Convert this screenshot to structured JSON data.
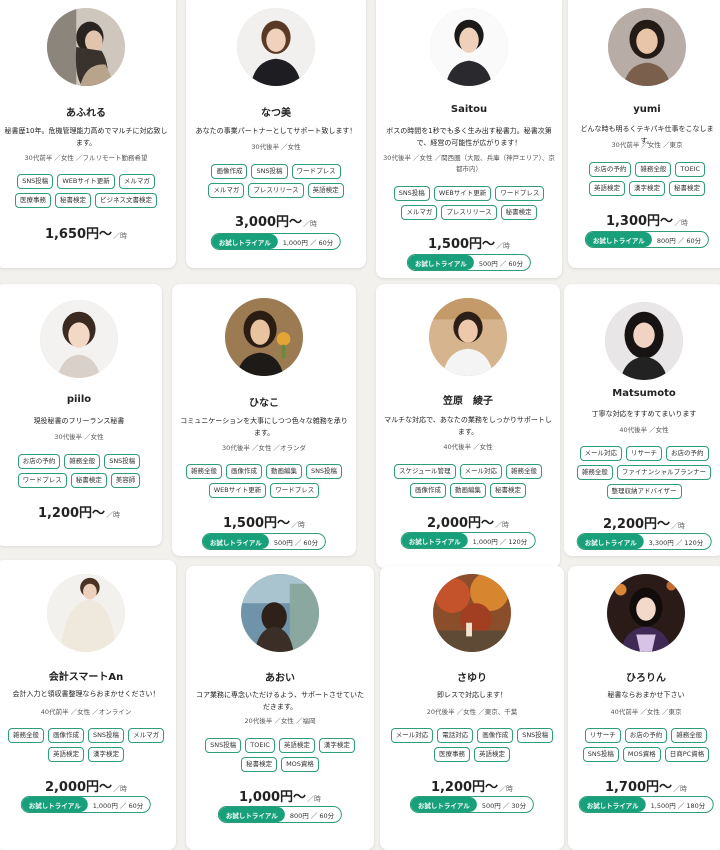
{
  "cards": [
    {
      "name": "あふれる",
      "intro": "秘書歴10年。危機管理能力高めでマルチに対応致します。",
      "meta": "30代前半 ／女性 ／フルリモート勤務希望",
      "tags": [
        "SNS投稿",
        "WEBサイト更新",
        "メルマガ",
        "医療事務",
        "秘書検定",
        "ビジネス文書検定"
      ],
      "price": "1,650円〜",
      "unit": "／時",
      "trial_label": "",
      "trial_detail": "",
      "photo": "woman-long-hair-side"
    },
    {
      "name": "なつ美",
      "intro": "あなたの事業パートナーとしてサポート致します！",
      "meta": "30代後半 ／女性",
      "tags": [
        "画像作成",
        "SNS投稿",
        "ワードプレス",
        "メルマガ",
        "プレスリリース",
        "英語検定"
      ],
      "price": "3,000円〜",
      "unit": "／時",
      "trial_label": "お試しトライアル",
      "trial_detail": "1,000円 ／ 60分",
      "photo": "woman-short-hair"
    },
    {
      "name": "Saitou",
      "intro": "ボスの時間を1秒でも多く生み出す秘書力。秘書次第で、経営の可能性が広がります！",
      "meta": "30代後半 ／女性 ／関西圏（大阪、兵庫（神戸エリア）、京都市内）",
      "tags": [
        "SNS投稿",
        "WEBサイト更新",
        "ワードプレス",
        "メルマガ",
        "プレスリリース",
        "秘書検定"
      ],
      "price": "1,500円〜",
      "unit": "／時",
      "trial_label": "お試しトライアル",
      "trial_detail": "500円 ／ 60分",
      "photo": "woman-tied-hair"
    },
    {
      "name": "yumi",
      "intro": "どんな時も明るくテキパキ仕事をこなします。",
      "meta": "30代前半 ／女性 ／東京",
      "tags": [
        "お店の予約",
        "雑務全般",
        "TOEIC",
        "英語検定",
        "漢字検定",
        "秘書検定"
      ],
      "price": "1,300円〜",
      "unit": "／時",
      "trial_label": "お試しトライアル",
      "trial_detail": "800円 ／ 60分",
      "photo": "woman-dark-hair"
    },
    {
      "name": "piilo",
      "intro": "現役秘書のフリーランス秘書",
      "meta": "30代後半 ／女性",
      "tags": [
        "お店の予約",
        "雑務全般",
        "SNS投稿",
        "ワードプレス",
        "秘書検定",
        "美容師"
      ],
      "price": "1,200円〜",
      "unit": "／時",
      "trial_label": "",
      "trial_detail": "",
      "photo": "woman-bangs"
    },
    {
      "name": "ひなこ",
      "intro": "コミュニケーションを大事にしつつ色々な雑務を承ります。",
      "meta": "30代後半 ／女性 ／オランダ",
      "tags": [
        "雑務全般",
        "画像作成",
        "動画編集",
        "SNS投稿",
        "WEBサイト更新",
        "ワードプレス"
      ],
      "price": "1,500円〜",
      "unit": "／時",
      "trial_label": "お試しトライアル",
      "trial_detail": "500円 ／ 60分",
      "photo": "woman-holding-flower"
    },
    {
      "name": "笠原　綾子",
      "intro": "マルチな対応で、あなたの業務をしっかりサポートします。",
      "meta": "40代後半 ／女性",
      "tags": [
        "スケジュール管理",
        "メール対応",
        "雑務全般",
        "画像作成",
        "動画編集",
        "秘書検定"
      ],
      "price": "2,000円〜",
      "unit": "／時",
      "trial_label": "お試しトライアル",
      "trial_detail": "1,000円 ／ 120分",
      "photo": "woman-white-shirt"
    },
    {
      "name": "Matsumoto",
      "intro": "丁寧な対応をすすめてまいります",
      "meta": "40代後半 ／女性",
      "tags": [
        "メール対応",
        "リサーチ",
        "お店の予約",
        "雑務全般",
        "ファイナンシャルプランナー",
        "整理収納アドバイザー"
      ],
      "price": "2,200円〜",
      "unit": "／時",
      "trial_label": "お試しトライアル",
      "trial_detail": "3,300円 ／ 120分",
      "photo": "woman-long-dark-hair"
    },
    {
      "name": "会計スマートAn",
      "intro": "会計入力と領収書整理ならおまかせください！",
      "meta": "40代前半 ／女性 ／オンライン",
      "tags": [
        "雑務全般",
        "画像作成",
        "SNS投稿",
        "メルマガ",
        "英語検定",
        "漢字検定"
      ],
      "price": "2,000円〜",
      "unit": "／時",
      "trial_label": "お試しトライアル",
      "trial_detail": "1,000円 ／ 60分",
      "photo": "woman-knit-sweater"
    },
    {
      "name": "あおい",
      "intro": "コア業務に専念いただけるよう、サポートさせていただきます。",
      "meta": "20代後半 ／女性 ／福岡",
      "tags": [
        "SNS投稿",
        "TOEIC",
        "英語検定",
        "漢字検定",
        "秘書検定",
        "MOS資格"
      ],
      "price": "1,000円〜",
      "unit": "／時",
      "trial_label": "お試しトライアル",
      "trial_detail": "800円 ／ 60分",
      "photo": "woman-back-view"
    },
    {
      "name": "さゆり",
      "intro": "即レスで対応します！",
      "meta": "20代後半 ／女性 ／東京、千葉",
      "tags": [
        "メール対応",
        "電話対応",
        "画像作成",
        "SNS投稿",
        "医療事務",
        "英語検定"
      ],
      "price": "1,200円〜",
      "unit": "／時",
      "trial_label": "お試しトライアル",
      "trial_detail": "500円 ／ 30分",
      "photo": "autumn-trees"
    },
    {
      "name": "ひろりん",
      "intro": "秘書ならおまかせ下さい",
      "meta": "40代前半 ／女性 ／東京",
      "tags": [
        "リサーチ",
        "お店の予約",
        "雑務全般",
        "SNS投稿",
        "MOS資格",
        "日商PC資格"
      ],
      "price": "1,700円〜",
      "unit": "／時",
      "trial_label": "お試しトライアル",
      "trial_detail": "1,500円 ／ 180分",
      "photo": "woman-kimono"
    }
  ]
}
